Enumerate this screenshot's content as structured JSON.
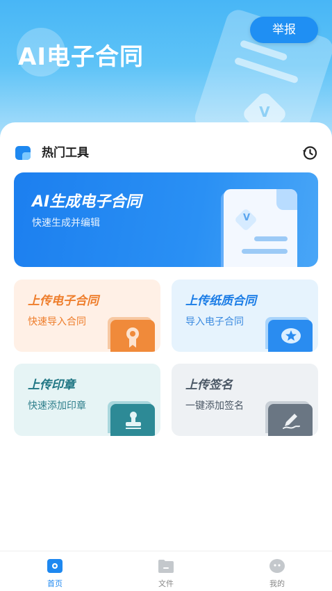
{
  "header": {
    "title": "AI电子合同",
    "report_button": "举报",
    "badge_letter": "V"
  },
  "tools": {
    "section_title": "热门工具",
    "ai_card": {
      "title": "AI生成电子合同",
      "subtitle": "快速生成并编辑",
      "seal_letter": "V"
    },
    "cards": [
      {
        "title": "上传电子合同",
        "subtitle": "快速导入合同",
        "icon": "certificate-icon",
        "accent": "#f08a3a"
      },
      {
        "title": "上传纸质合同",
        "subtitle": "导入电子合同",
        "icon": "star-badge-icon",
        "accent": "#2a8cf0"
      },
      {
        "title": "上传印章",
        "subtitle": "快速添加印章",
        "icon": "stamp-icon",
        "accent": "#2d8a96"
      },
      {
        "title": "上传签名",
        "subtitle": "一键添加签名",
        "icon": "signature-pen-icon",
        "accent": "#6a7683"
      }
    ]
  },
  "tabbar": {
    "items": [
      {
        "label": "首页",
        "icon": "home-icon",
        "active": true
      },
      {
        "label": "文件",
        "icon": "folder-icon",
        "active": false
      },
      {
        "label": "我的",
        "icon": "profile-icon",
        "active": false
      }
    ]
  },
  "colors": {
    "primary": "#1e88f0",
    "header_top": "#48b6f6"
  }
}
